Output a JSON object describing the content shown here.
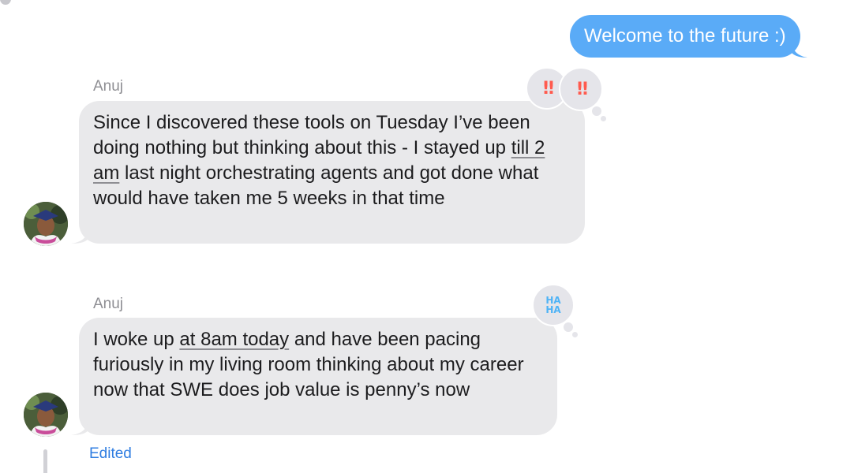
{
  "outgoing": {
    "text": "Welcome to the future :)",
    "bubble_color": "#5aabf7"
  },
  "messages": [
    {
      "sender": "Anuj",
      "segments": [
        "Since I discovered these tools on Tuesday I’ve been doing nothing but thinking about this - I stayed up ",
        "till 2 am",
        " last night orchestrating agents and got done what would have taken me 5 weeks in that time"
      ],
      "reaction": "exclamation-icon",
      "reaction_glyph": "‼"
    },
    {
      "sender": "Anuj",
      "segments": [
        "I woke up ",
        "at 8am today",
        " and have been pacing furiously in my living room thinking about my career now that SWE does job value is penny’s now"
      ],
      "reaction": "haha-icon",
      "reaction_glyph_top": "HA",
      "reaction_glyph_bottom": "HA",
      "status": "Edited"
    }
  ],
  "colors": {
    "incoming_bubble": "#e9e9eb",
    "sender_text": "#8e8e93",
    "edited_text": "#2f7de1",
    "exclaim_reaction": "#ff5a4e",
    "haha_reaction": "#4fb3f6"
  }
}
